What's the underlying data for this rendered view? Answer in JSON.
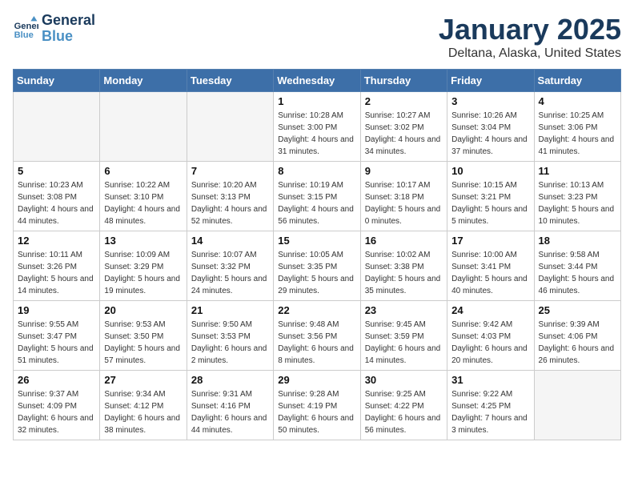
{
  "header": {
    "logo_line1": "General",
    "logo_line2": "Blue",
    "month": "January 2025",
    "location": "Deltana, Alaska, United States"
  },
  "weekdays": [
    "Sunday",
    "Monday",
    "Tuesday",
    "Wednesday",
    "Thursday",
    "Friday",
    "Saturday"
  ],
  "weeks": [
    [
      {
        "day": "",
        "sunrise": "",
        "sunset": "",
        "daylight": ""
      },
      {
        "day": "",
        "sunrise": "",
        "sunset": "",
        "daylight": ""
      },
      {
        "day": "",
        "sunrise": "",
        "sunset": "",
        "daylight": ""
      },
      {
        "day": "1",
        "sunrise": "Sunrise: 10:28 AM",
        "sunset": "Sunset: 3:00 PM",
        "daylight": "Daylight: 4 hours and 31 minutes."
      },
      {
        "day": "2",
        "sunrise": "Sunrise: 10:27 AM",
        "sunset": "Sunset: 3:02 PM",
        "daylight": "Daylight: 4 hours and 34 minutes."
      },
      {
        "day": "3",
        "sunrise": "Sunrise: 10:26 AM",
        "sunset": "Sunset: 3:04 PM",
        "daylight": "Daylight: 4 hours and 37 minutes."
      },
      {
        "day": "4",
        "sunrise": "Sunrise: 10:25 AM",
        "sunset": "Sunset: 3:06 PM",
        "daylight": "Daylight: 4 hours and 41 minutes."
      }
    ],
    [
      {
        "day": "5",
        "sunrise": "Sunrise: 10:23 AM",
        "sunset": "Sunset: 3:08 PM",
        "daylight": "Daylight: 4 hours and 44 minutes."
      },
      {
        "day": "6",
        "sunrise": "Sunrise: 10:22 AM",
        "sunset": "Sunset: 3:10 PM",
        "daylight": "Daylight: 4 hours and 48 minutes."
      },
      {
        "day": "7",
        "sunrise": "Sunrise: 10:20 AM",
        "sunset": "Sunset: 3:13 PM",
        "daylight": "Daylight: 4 hours and 52 minutes."
      },
      {
        "day": "8",
        "sunrise": "Sunrise: 10:19 AM",
        "sunset": "Sunset: 3:15 PM",
        "daylight": "Daylight: 4 hours and 56 minutes."
      },
      {
        "day": "9",
        "sunrise": "Sunrise: 10:17 AM",
        "sunset": "Sunset: 3:18 PM",
        "daylight": "Daylight: 5 hours and 0 minutes."
      },
      {
        "day": "10",
        "sunrise": "Sunrise: 10:15 AM",
        "sunset": "Sunset: 3:21 PM",
        "daylight": "Daylight: 5 hours and 5 minutes."
      },
      {
        "day": "11",
        "sunrise": "Sunrise: 10:13 AM",
        "sunset": "Sunset: 3:23 PM",
        "daylight": "Daylight: 5 hours and 10 minutes."
      }
    ],
    [
      {
        "day": "12",
        "sunrise": "Sunrise: 10:11 AM",
        "sunset": "Sunset: 3:26 PM",
        "daylight": "Daylight: 5 hours and 14 minutes."
      },
      {
        "day": "13",
        "sunrise": "Sunrise: 10:09 AM",
        "sunset": "Sunset: 3:29 PM",
        "daylight": "Daylight: 5 hours and 19 minutes."
      },
      {
        "day": "14",
        "sunrise": "Sunrise: 10:07 AM",
        "sunset": "Sunset: 3:32 PM",
        "daylight": "Daylight: 5 hours and 24 minutes."
      },
      {
        "day": "15",
        "sunrise": "Sunrise: 10:05 AM",
        "sunset": "Sunset: 3:35 PM",
        "daylight": "Daylight: 5 hours and 29 minutes."
      },
      {
        "day": "16",
        "sunrise": "Sunrise: 10:02 AM",
        "sunset": "Sunset: 3:38 PM",
        "daylight": "Daylight: 5 hours and 35 minutes."
      },
      {
        "day": "17",
        "sunrise": "Sunrise: 10:00 AM",
        "sunset": "Sunset: 3:41 PM",
        "daylight": "Daylight: 5 hours and 40 minutes."
      },
      {
        "day": "18",
        "sunrise": "Sunrise: 9:58 AM",
        "sunset": "Sunset: 3:44 PM",
        "daylight": "Daylight: 5 hours and 46 minutes."
      }
    ],
    [
      {
        "day": "19",
        "sunrise": "Sunrise: 9:55 AM",
        "sunset": "Sunset: 3:47 PM",
        "daylight": "Daylight: 5 hours and 51 minutes."
      },
      {
        "day": "20",
        "sunrise": "Sunrise: 9:53 AM",
        "sunset": "Sunset: 3:50 PM",
        "daylight": "Daylight: 5 hours and 57 minutes."
      },
      {
        "day": "21",
        "sunrise": "Sunrise: 9:50 AM",
        "sunset": "Sunset: 3:53 PM",
        "daylight": "Daylight: 6 hours and 2 minutes."
      },
      {
        "day": "22",
        "sunrise": "Sunrise: 9:48 AM",
        "sunset": "Sunset: 3:56 PM",
        "daylight": "Daylight: 6 hours and 8 minutes."
      },
      {
        "day": "23",
        "sunrise": "Sunrise: 9:45 AM",
        "sunset": "Sunset: 3:59 PM",
        "daylight": "Daylight: 6 hours and 14 minutes."
      },
      {
        "day": "24",
        "sunrise": "Sunrise: 9:42 AM",
        "sunset": "Sunset: 4:03 PM",
        "daylight": "Daylight: 6 hours and 20 minutes."
      },
      {
        "day": "25",
        "sunrise": "Sunrise: 9:39 AM",
        "sunset": "Sunset: 4:06 PM",
        "daylight": "Daylight: 6 hours and 26 minutes."
      }
    ],
    [
      {
        "day": "26",
        "sunrise": "Sunrise: 9:37 AM",
        "sunset": "Sunset: 4:09 PM",
        "daylight": "Daylight: 6 hours and 32 minutes."
      },
      {
        "day": "27",
        "sunrise": "Sunrise: 9:34 AM",
        "sunset": "Sunset: 4:12 PM",
        "daylight": "Daylight: 6 hours and 38 minutes."
      },
      {
        "day": "28",
        "sunrise": "Sunrise: 9:31 AM",
        "sunset": "Sunset: 4:16 PM",
        "daylight": "Daylight: 6 hours and 44 minutes."
      },
      {
        "day": "29",
        "sunrise": "Sunrise: 9:28 AM",
        "sunset": "Sunset: 4:19 PM",
        "daylight": "Daylight: 6 hours and 50 minutes."
      },
      {
        "day": "30",
        "sunrise": "Sunrise: 9:25 AM",
        "sunset": "Sunset: 4:22 PM",
        "daylight": "Daylight: 6 hours and 56 minutes."
      },
      {
        "day": "31",
        "sunrise": "Sunrise: 9:22 AM",
        "sunset": "Sunset: 4:25 PM",
        "daylight": "Daylight: 7 hours and 3 minutes."
      },
      {
        "day": "",
        "sunrise": "",
        "sunset": "",
        "daylight": ""
      }
    ]
  ]
}
